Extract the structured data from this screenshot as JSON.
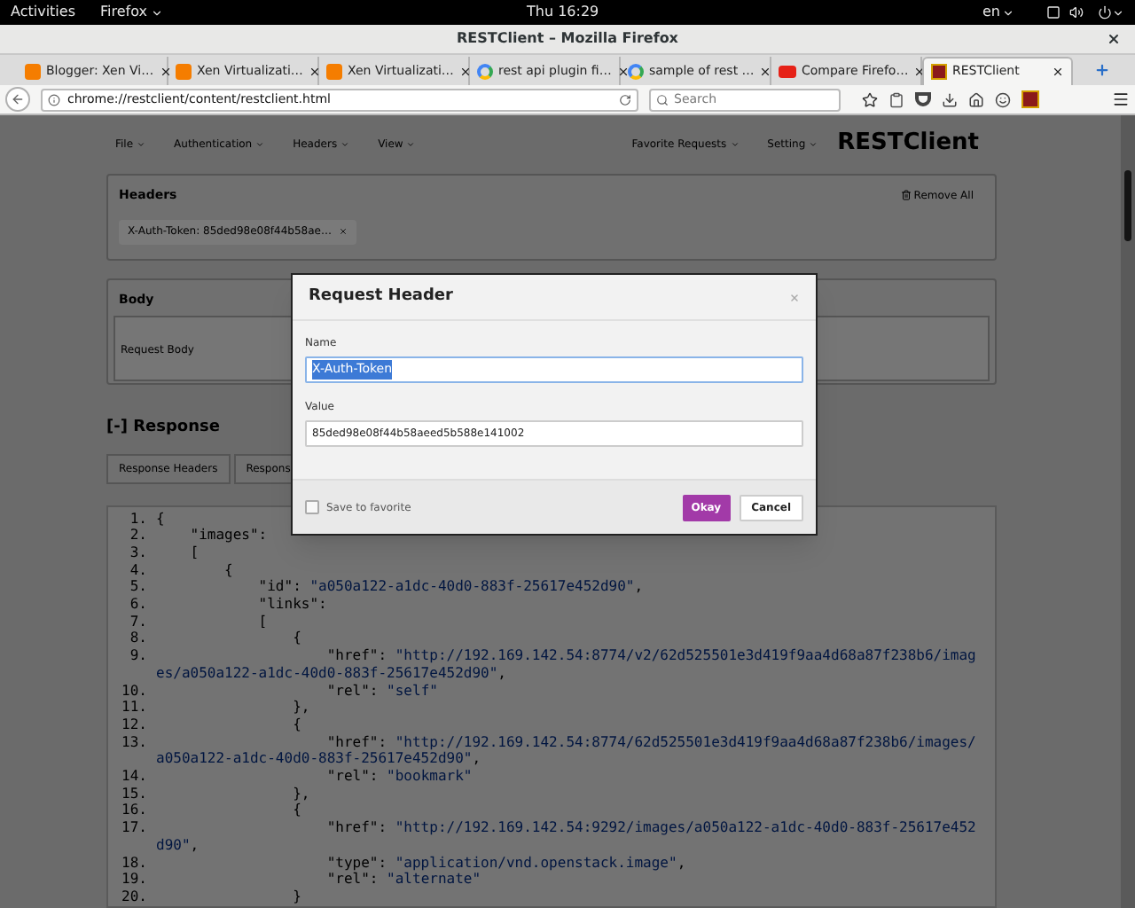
{
  "system_bar": {
    "activities": "Activities",
    "app": "Firefox",
    "clock": "Thu 16:29",
    "language": "en"
  },
  "window": {
    "title": "RESTClient – Mozilla Firefox"
  },
  "tabs": [
    {
      "label": "Blogger: Xen Vi…",
      "kind": "blogger",
      "selected": false
    },
    {
      "label": "Xen Virtualizati…",
      "kind": "blogger",
      "selected": false
    },
    {
      "label": "Xen Virtualizati…",
      "kind": "blogger",
      "selected": false
    },
    {
      "label": "rest api plugin fi…",
      "kind": "google",
      "selected": false
    },
    {
      "label": "sample of rest …",
      "kind": "google",
      "selected": false
    },
    {
      "label": "Compare Firefo…",
      "kind": "youtube",
      "selected": false
    },
    {
      "label": "RESTClient",
      "kind": "restclient",
      "selected": true
    }
  ],
  "address_bar": {
    "url": "chrome://restclient/content/restclient.html"
  },
  "search": {
    "placeholder": "Search"
  },
  "page": {
    "menu": [
      "File",
      "Authentication",
      "Headers",
      "View"
    ],
    "menu_right": [
      "Favorite Requests",
      "Setting"
    ],
    "brand": "RESTClient",
    "headers_panel": {
      "title": "Headers",
      "remove_all": "Remove All",
      "chips": [
        {
          "label": "X-Auth-Token: 85ded98e08f44b58ae…"
        }
      ]
    },
    "body_panel": {
      "title": "Body",
      "placeholder": "Request Body"
    },
    "response": {
      "title": "[-] Response",
      "tabs": [
        "Response Headers",
        "Respons"
      ],
      "code_lines": [
        {
          "number": "1.",
          "code": "{"
        },
        {
          "number": "2.",
          "code": "    \"images\":"
        },
        {
          "number": "3.",
          "code": "    ["
        },
        {
          "number": "4.",
          "code": "        {"
        },
        {
          "number": "5.",
          "code": "            \"id\": ",
          "value": "\"a050a122-a1dc-40d0-883f-25617e452d90\"",
          "tail": ","
        },
        {
          "number": "6.",
          "code": "            \"links\":"
        },
        {
          "number": "7.",
          "code": "            ["
        },
        {
          "number": "8.",
          "code": "                {"
        },
        {
          "number": "9.",
          "code": "                    \"href\": ",
          "value": "\"http://192.169.142.54:8774/v2/62d525501e3d419f9aa4d68a87f238b6/imag",
          "continuation": "es/a050a122-a1dc-40d0-883f-25617e452d90\"",
          "tail": ","
        },
        {
          "number": "10.",
          "code": "                    \"rel\": ",
          "value": "\"self\""
        },
        {
          "number": "11.",
          "code": "                },"
        },
        {
          "number": "12.",
          "code": "                {"
        },
        {
          "number": "13.",
          "code": "                    \"href\": ",
          "value": "\"http://192.169.142.54:8774/62d525501e3d419f9aa4d68a87f238b6/images/",
          "continuation": "a050a122-a1dc-40d0-883f-25617e452d90\"",
          "tail": ","
        },
        {
          "number": "14.",
          "code": "                    \"rel\": ",
          "value": "\"bookmark\""
        },
        {
          "number": "15.",
          "code": "                },"
        },
        {
          "number": "16.",
          "code": "                {"
        },
        {
          "number": "17.",
          "code": "                    \"href\": ",
          "value": "\"http://192.169.142.54:9292/images/a050a122-a1dc-40d0-883f-25617e452",
          "continuation": "d90\"",
          "tail": ","
        },
        {
          "number": "18.",
          "code": "                    \"type\": ",
          "value": "\"application/vnd.openstack.image\"",
          "tail": ","
        },
        {
          "number": "19.",
          "code": "                    \"rel\": ",
          "value": "\"alternate\""
        },
        {
          "number": "20.",
          "code": "                }"
        }
      ]
    }
  },
  "dialog": {
    "title": "Request Header",
    "name_label": "Name",
    "name_value": "X-Auth-Token",
    "name_text_selected": true,
    "value_label": "Value",
    "value_value": "85ded98e08f44b58aeed5b588e141002",
    "save_label": "Save to favorite",
    "save_checked": false,
    "okay": "Okay",
    "cancel": "Cancel"
  }
}
